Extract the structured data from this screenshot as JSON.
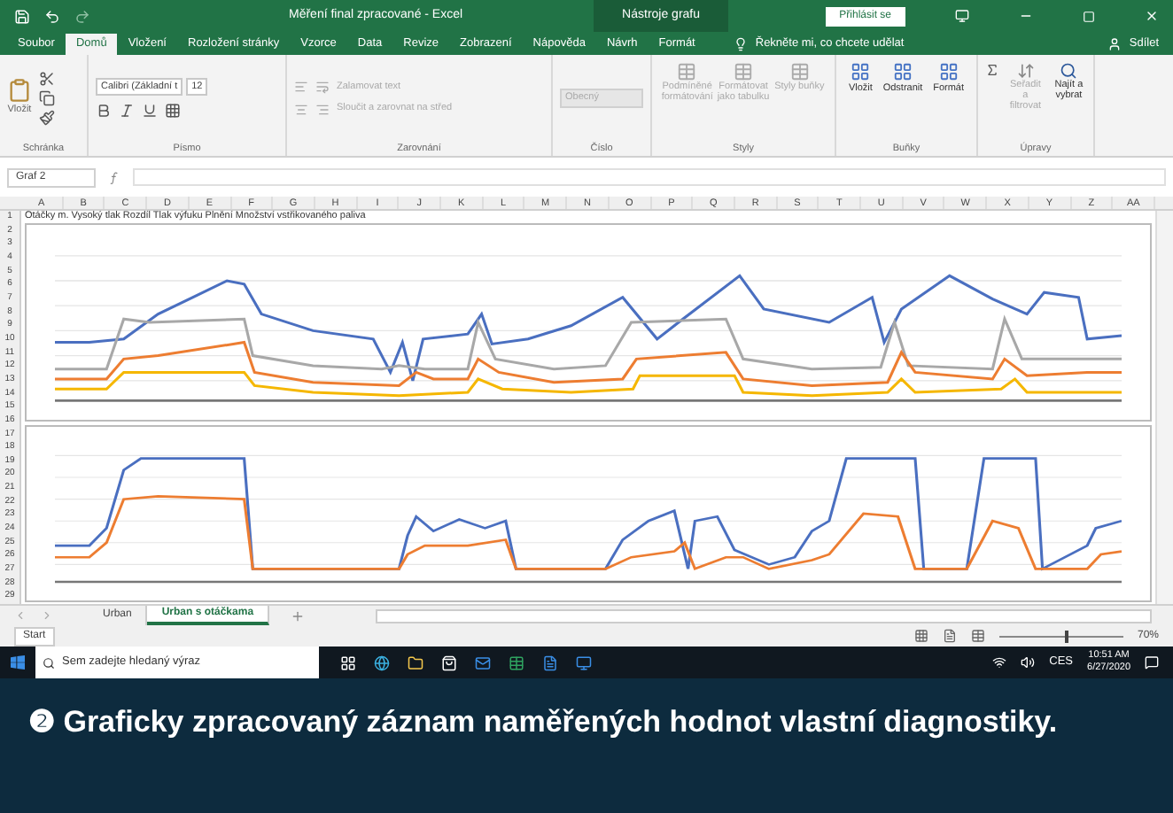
{
  "window": {
    "title": "Měření final zpracované - Excel",
    "context_tab": "Nástroje grafu",
    "sign_in": "Přihlásit se"
  },
  "ribbon_tabs": [
    {
      "label": "Soubor",
      "selected": false
    },
    {
      "label": "Domů",
      "selected": true
    },
    {
      "label": "Vložení",
      "selected": false
    },
    {
      "label": "Rozložení stránky",
      "selected": false
    },
    {
      "label": "Vzorce",
      "selected": false
    },
    {
      "label": "Data",
      "selected": false
    },
    {
      "label": "Revize",
      "selected": false
    },
    {
      "label": "Zobrazení",
      "selected": false
    },
    {
      "label": "Nápověda",
      "selected": false
    },
    {
      "label": "Návrh",
      "selected": false
    },
    {
      "label": "Formát",
      "selected": false
    }
  ],
  "tell_me": "Řekněte mi, co chcete udělat",
  "share": "Sdílet",
  "ribbon": {
    "paste": "Vložit",
    "font_name": "Calibri (Základní t",
    "font_size": "12",
    "wrap_text": "Zalamovat text",
    "merge": "Sloučit a zarovnat na střed",
    "number_format": "Obecný",
    "styles": [
      "Podmíněné formátování",
      "Formátovat jako tabulku",
      "Styly buňky"
    ],
    "cells": [
      "Vložit",
      "Odstranit",
      "Formát"
    ],
    "editing": [
      "Seřadit a filtrovat",
      "Najít a vybrat"
    ],
    "groups": [
      "Schránka",
      "Písmo",
      "Zarovnání",
      "Číslo",
      "Styly",
      "Buňky",
      "Úpravy"
    ]
  },
  "name_box": "Graf 2",
  "columns": [
    "A",
    "B",
    "C",
    "D",
    "E",
    "F",
    "G",
    "H",
    "I",
    "J",
    "K",
    "L",
    "M",
    "N",
    "O",
    "P",
    "Q",
    "R",
    "S",
    "T",
    "U",
    "V",
    "W",
    "X",
    "Y",
    "Z",
    "AA"
  ],
  "rows": [
    "1",
    "2",
    "3",
    "4",
    "5",
    "6",
    "7",
    "8",
    "9",
    "10",
    "11",
    "12",
    "13",
    "14",
    "15",
    "16",
    "17",
    "18",
    "19",
    "20",
    "21",
    "22",
    "23",
    "24",
    "25",
    "26",
    "27",
    "28",
    "29"
  ],
  "header_cell": "Otáčky m. Vysoký tlak Rozdíl Tlak výfuku Plnění Množství vstřikovaného paliva",
  "sheet_tabs": [
    {
      "label": "Urban",
      "selected": false
    },
    {
      "label": "Urban s otáčkama",
      "selected": true
    }
  ],
  "status": {
    "mode": "Start",
    "zoom": "70%",
    "zoom_slider": {
      "level": 0.55
    }
  },
  "taskbar": {
    "search_placeholder": "Sem zadejte hledaný výraz",
    "language": "CES",
    "time": "10:51 AM",
    "date": "6/27/2020"
  },
  "caption": {
    "number": "❷",
    "text": "Graficky zpracovaný záznam naměřených hodnot vlastní diagnostiky."
  }
}
